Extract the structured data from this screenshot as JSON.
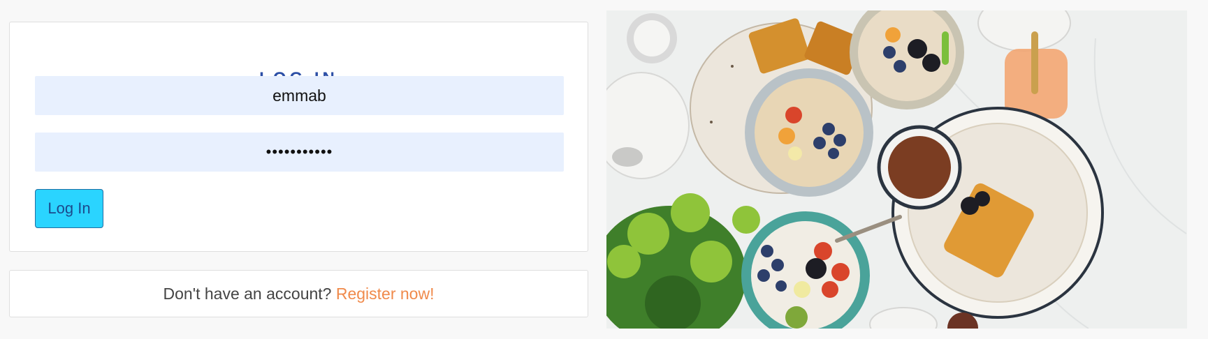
{
  "login": {
    "title": "LOG IN",
    "username_value": "emmab",
    "password_value": "•••••••••••",
    "submit_label": "Log In"
  },
  "register": {
    "prompt": "Don't have an account?",
    "link_label": "Register now!"
  },
  "colors": {
    "title": "#2c4fa6",
    "input_background": "#e8f0fe",
    "button_background": "#2ad4ff",
    "link": "#f08a4b"
  },
  "image": {
    "subject": "breakfast-table-photo"
  }
}
